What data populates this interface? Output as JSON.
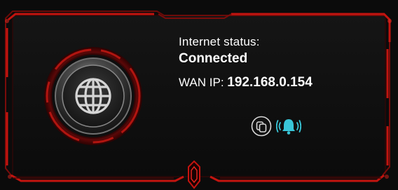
{
  "internet": {
    "status_label": "Internet status:",
    "status_value": "Connected",
    "wan_label": "WAN IP:",
    "wan_ip": "192.168.0.154"
  },
  "icons": {
    "globe": "globe-icon",
    "copy": "copy-icon",
    "notify": "bell-icon"
  },
  "colors": {
    "accent_red": "#c3140f",
    "bell_cyan": "#39c6d8",
    "text": "#ffffff",
    "panel_bg": "#0c0c0c"
  }
}
